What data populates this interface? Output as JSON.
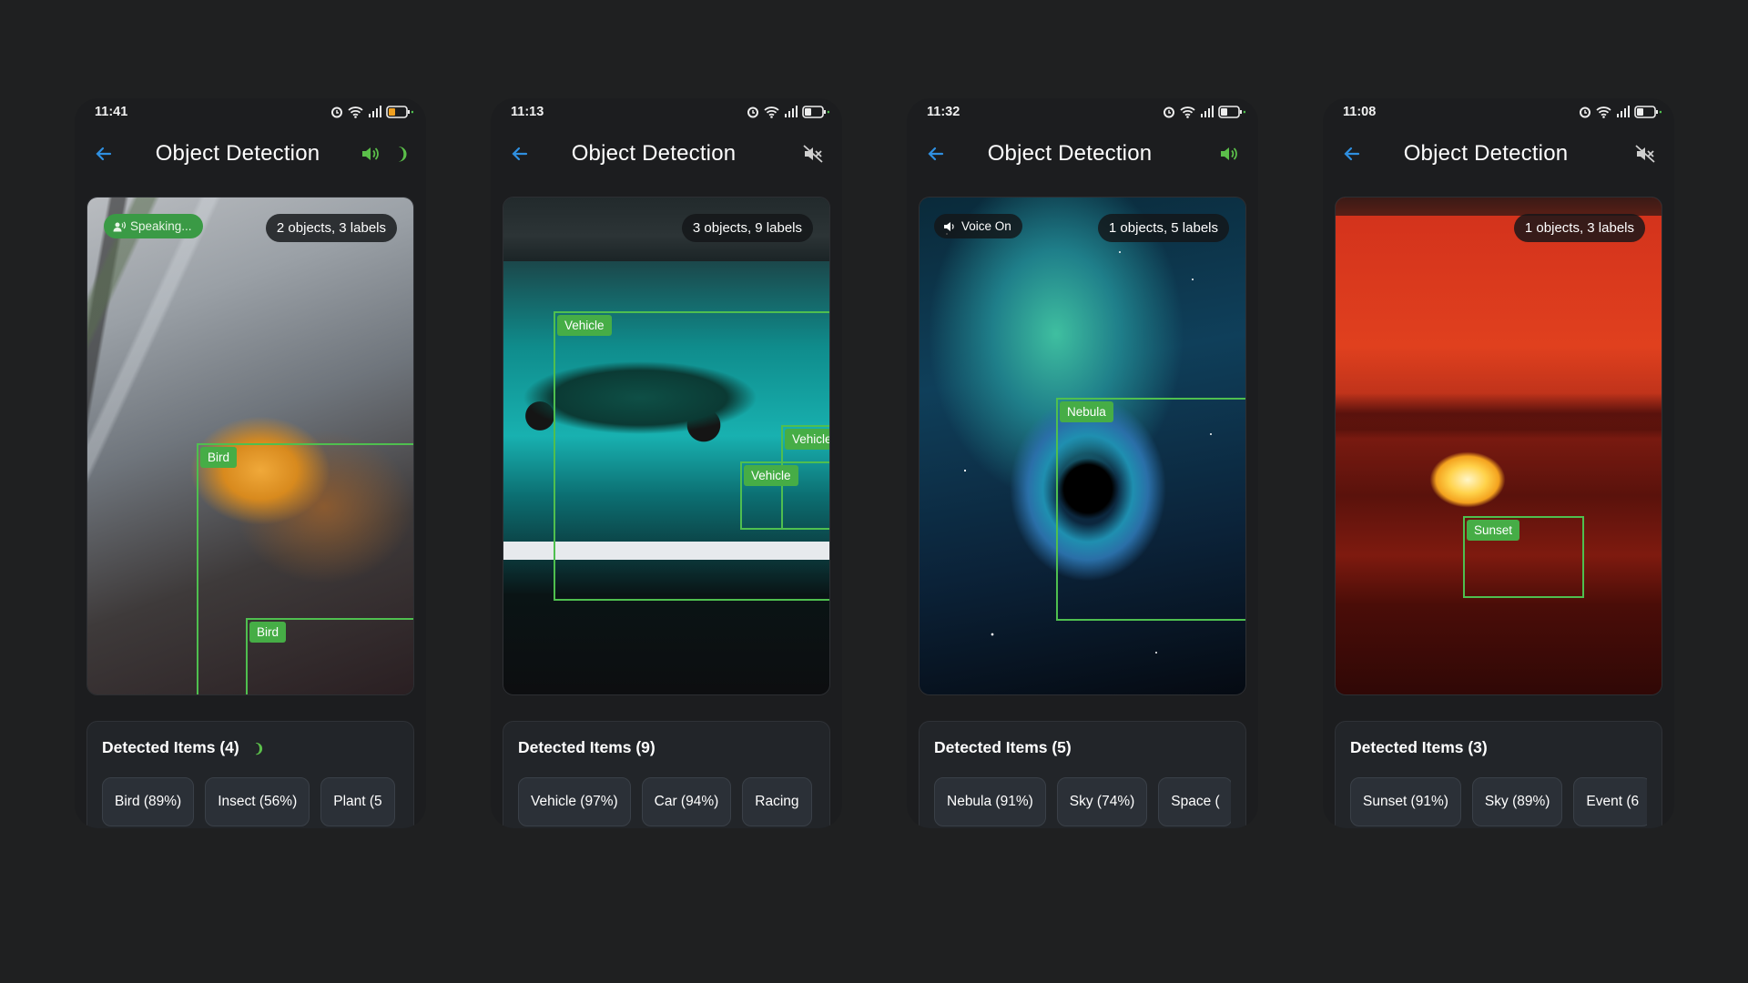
{
  "phones": [
    {
      "time": "11:41",
      "title": "Object Detection",
      "speaker": "on",
      "speaker_icon": "speaker-on-icon",
      "summary": "2 objects, 3 labels",
      "overlay_pill": "Speaking...",
      "boxes": [
        {
          "label": "Bird"
        },
        {
          "label": "Bird"
        }
      ],
      "detected_title": "Detected Items (4)",
      "chips": [
        "Bird (89%)",
        "Insect (56%)",
        "Plant (5"
      ]
    },
    {
      "time": "11:13",
      "title": "Object Detection",
      "speaker": "muted",
      "speaker_icon": "speaker-muted-icon",
      "summary": "3 objects, 9 labels",
      "boxes": [
        {
          "label": "Vehicle"
        },
        {
          "label": "Vehicle"
        },
        {
          "label": "Vehicle"
        }
      ],
      "detected_title": "Detected Items (9)",
      "chips": [
        "Vehicle (97%)",
        "Car (94%)",
        "Racing"
      ]
    },
    {
      "time": "11:32",
      "title": "Object Detection",
      "speaker": "on",
      "speaker_icon": "speaker-on-icon",
      "summary": "1 objects, 5 labels",
      "overlay_pill": "Voice On",
      "boxes": [
        {
          "label": "Nebula"
        }
      ],
      "detected_title": "Detected Items (5)",
      "chips": [
        "Nebula (91%)",
        "Sky (74%)",
        "Space ("
      ]
    },
    {
      "time": "11:08",
      "title": "Object Detection",
      "speaker": "muted",
      "speaker_icon": "speaker-muted-icon",
      "summary": "1 objects, 3 labels",
      "boxes": [
        {
          "label": "Sunset"
        }
      ],
      "detected_title": "Detected Items (3)",
      "chips": [
        "Sunset (91%)",
        "Sky (89%)",
        "Event (6"
      ]
    }
  ],
  "colors": {
    "background": "#1f2021",
    "accent_green": "#4fbf4f",
    "back_arrow_blue": "#2f8fe0"
  }
}
